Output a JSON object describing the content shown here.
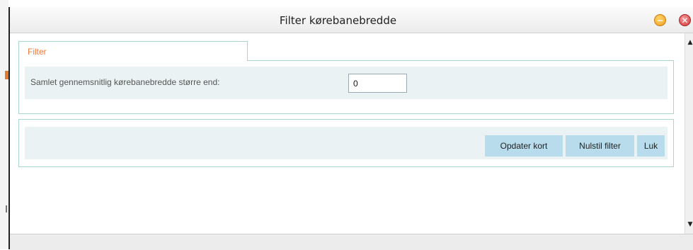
{
  "window": {
    "title": "Filter kørebanebredde",
    "minimize_icon": "minimize-icon",
    "close_icon": "close-icon",
    "minimize_glyph": "−",
    "close_glyph": "✕"
  },
  "tabs": [
    {
      "label": "Filter",
      "active": true,
      "color": "#f07a3c"
    }
  ],
  "filter": {
    "label": "Samlet gennemsnitlig kørebanebredde større end:",
    "value": "0"
  },
  "buttons": {
    "update": "Opdater kort",
    "reset": "Nulstil filter",
    "close": "Luk"
  },
  "scroll": {
    "up_glyph": "▲",
    "down_glyph": "▼"
  },
  "colors": {
    "accent": "#f07a3c",
    "panel_bg": "#eaf2f4",
    "button_bg": "#b9dcec",
    "border": "#a9d6cf"
  }
}
